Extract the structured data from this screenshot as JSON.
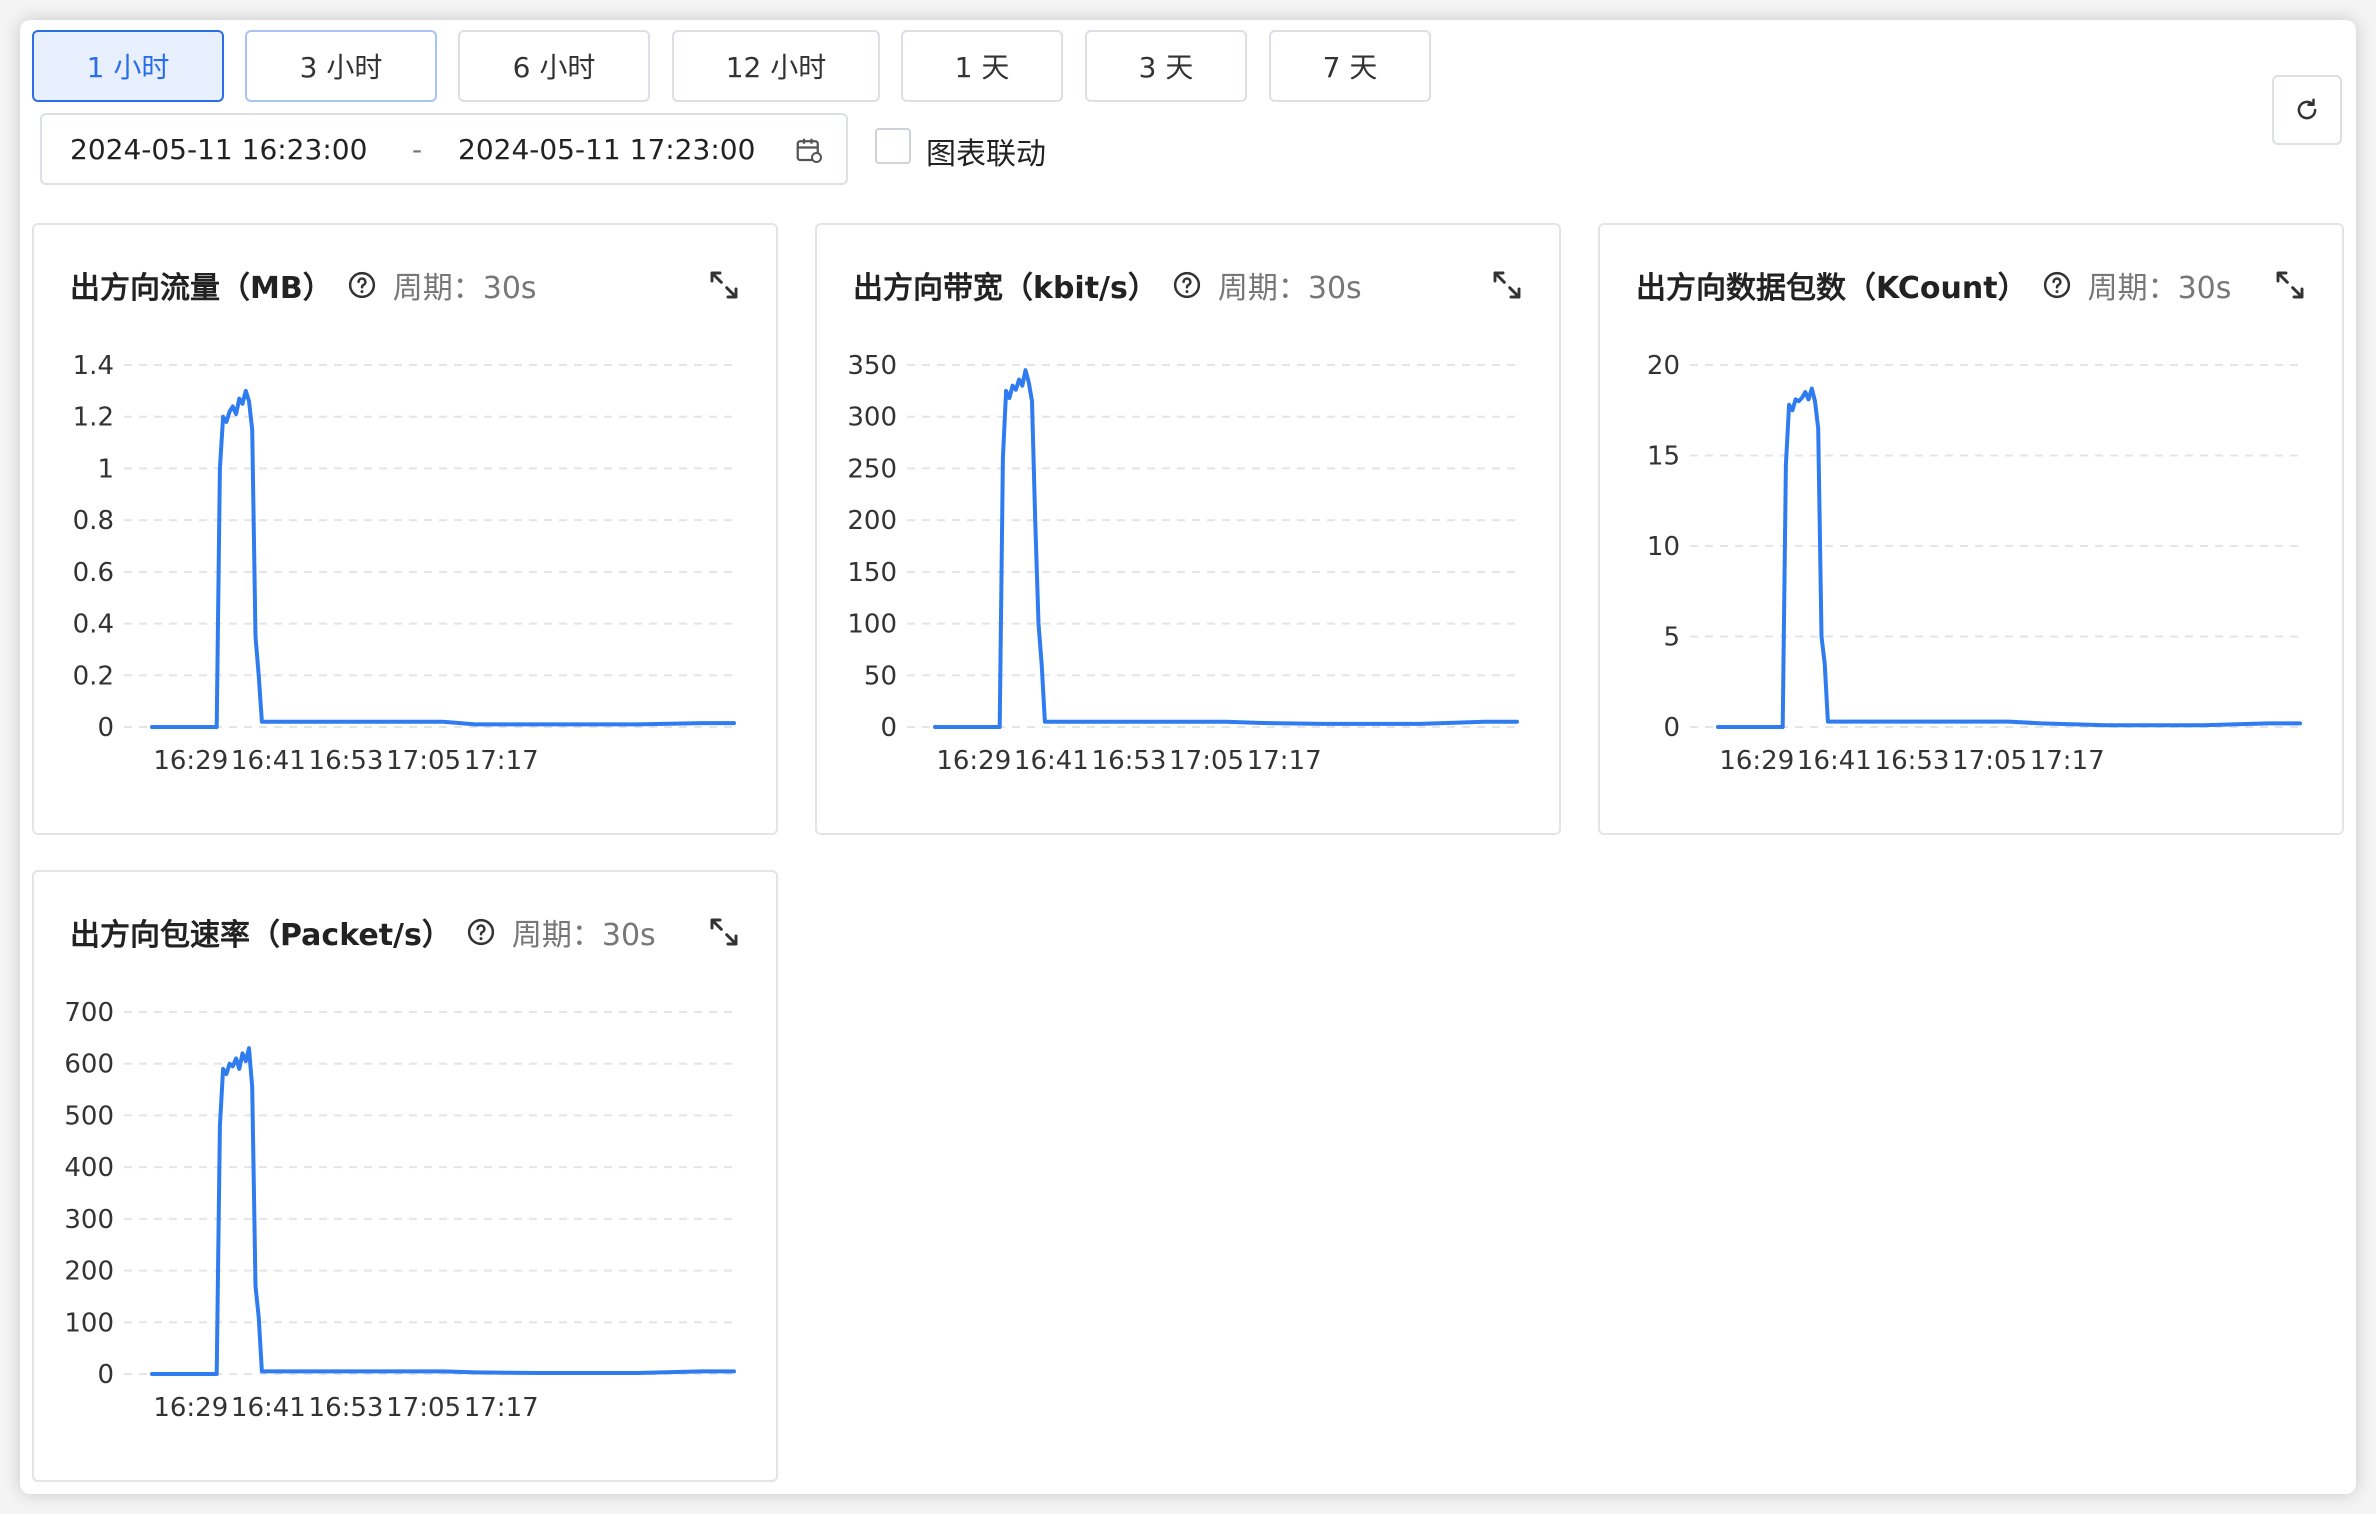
{
  "toolbar": {
    "ranges": [
      "1 小时",
      "3 小时",
      "6 小时",
      "12 小时",
      "1 天",
      "3 天",
      "7 天"
    ],
    "active_range": "1 小时",
    "date_start": "2024-05-11 16:23:00",
    "date_separator": "-",
    "date_end": "2024-05-11 17:23:00",
    "link_label": "图表联动",
    "link_checked": false
  },
  "colors": {
    "accent": "#2b6fe8",
    "line": "#2f7bf0",
    "grid": "#e3e5e8"
  },
  "chart_data": [
    {
      "type": "line",
      "title": "出方向流量（MB）",
      "period": "周期：30s",
      "xticks": [
        "16:29",
        "16:41",
        "16:53",
        "17:05",
        "17:17"
      ],
      "yticks": [
        "0",
        "0.2",
        "0.4",
        "0.6",
        "0.8",
        "1",
        "1.2",
        "1.4"
      ],
      "ylim": [
        0,
        1.4
      ],
      "x_minutes": [
        0,
        10,
        10.5,
        11,
        11.5,
        12,
        12.5,
        13,
        13.5,
        14,
        14.5,
        15,
        15.5,
        16,
        16.5,
        17,
        17.5,
        18,
        19,
        25,
        35,
        45,
        50,
        60,
        70,
        75,
        85,
        90
      ],
      "x_time": [
        "16:23:00",
        "16:33:00",
        "16:33:30",
        "16:34:00",
        "16:34:30",
        "16:35:00",
        "16:35:30",
        "16:36:00",
        "16:36:30",
        "16:37:00",
        "16:37:30",
        "16:38:00",
        "16:38:30",
        "16:39:00",
        "16:39:30",
        "16:40:00",
        "16:40:30",
        "16:41:00",
        "16:42:00",
        "16:48:00",
        "16:58:00",
        "17:08:00",
        "17:13:00",
        "17:23:00",
        "17:33:00",
        "17:38:00",
        "17:48:00",
        "17:53:00"
      ],
      "values": [
        0,
        0,
        1.0,
        1.2,
        1.18,
        1.22,
        1.24,
        1.21,
        1.27,
        1.25,
        1.3,
        1.26,
        1.15,
        0.35,
        0.2,
        0.02,
        0.02,
        0.02,
        0.02,
        0.02,
        0.02,
        0.02,
        0.01,
        0.01,
        0.01,
        0.01,
        0.015,
        0.015
      ]
    },
    {
      "type": "line",
      "title": "出方向带宽（kbit/s）",
      "period": "周期：30s",
      "xticks": [
        "16:29",
        "16:41",
        "16:53",
        "17:05",
        "17:17"
      ],
      "yticks": [
        "0",
        "50",
        "100",
        "150",
        "200",
        "250",
        "300",
        "350"
      ],
      "ylim": [
        0,
        350
      ],
      "x_time": [
        "16:23:00",
        "16:33:00",
        "16:33:30",
        "16:34:00",
        "16:34:30",
        "16:35:00",
        "16:35:30",
        "16:36:00",
        "16:36:30",
        "16:37:00",
        "16:37:30",
        "16:38:00",
        "16:38:30",
        "16:39:00",
        "16:39:30",
        "16:40:00",
        "16:40:30",
        "16:41:00",
        "16:42:00",
        "16:48:00",
        "16:58:00",
        "17:08:00",
        "17:13:00",
        "17:23:00",
        "17:33:00",
        "17:38:00",
        "17:48:00",
        "17:53:00"
      ],
      "values": [
        0,
        0,
        260,
        325,
        318,
        330,
        326,
        336,
        330,
        345,
        333,
        315,
        200,
        100,
        60,
        5,
        5,
        5,
        5,
        5,
        5,
        5,
        4,
        3,
        3,
        3,
        5,
        5
      ]
    },
    {
      "type": "line",
      "title": "出方向数据包数（KCount）",
      "period": "周期：30s",
      "xticks": [
        "16:29",
        "16:41",
        "16:53",
        "17:05",
        "17:17"
      ],
      "yticks": [
        "0",
        "5",
        "10",
        "15",
        "20"
      ],
      "ylim": [
        0,
        20
      ],
      "x_time": [
        "16:23:00",
        "16:33:00",
        "16:33:30",
        "16:34:00",
        "16:34:30",
        "16:35:00",
        "16:35:30",
        "16:36:00",
        "16:36:30",
        "16:37:00",
        "16:37:30",
        "16:38:00",
        "16:38:30",
        "16:39:00",
        "16:39:30",
        "16:40:00",
        "16:40:30",
        "16:41:00",
        "16:42:00",
        "16:48:00",
        "16:58:00",
        "17:08:00",
        "17:13:00",
        "17:23:00",
        "17:33:00",
        "17:38:00",
        "17:48:00",
        "17:53:00"
      ],
      "values": [
        0,
        0,
        14.5,
        17.8,
        17.5,
        18.1,
        18.0,
        18.2,
        18.5,
        18.1,
        18.7,
        18.0,
        16.5,
        5.0,
        3.5,
        0.3,
        0.3,
        0.3,
        0.3,
        0.3,
        0.3,
        0.3,
        0.2,
        0.1,
        0.1,
        0.1,
        0.2,
        0.2
      ]
    },
    {
      "type": "line",
      "title": "出方向包速率（Packet/s）",
      "period": "周期：30s",
      "xticks": [
        "16:29",
        "16:41",
        "16:53",
        "17:05",
        "17:17"
      ],
      "yticks": [
        "0",
        "100",
        "200",
        "300",
        "400",
        "500",
        "600",
        "700"
      ],
      "ylim": [
        0,
        700
      ],
      "x_time": [
        "16:23:00",
        "16:33:00",
        "16:33:30",
        "16:34:00",
        "16:34:30",
        "16:35:00",
        "16:35:30",
        "16:36:00",
        "16:36:30",
        "16:37:00",
        "16:37:30",
        "16:38:00",
        "16:38:30",
        "16:39:00",
        "16:39:30",
        "16:40:00",
        "16:40:30",
        "16:41:00",
        "16:42:00",
        "16:48:00",
        "16:58:00",
        "17:08:00",
        "17:13:00",
        "17:23:00",
        "17:33:00",
        "17:38:00",
        "17:48:00",
        "17:53:00"
      ],
      "values": [
        0,
        0,
        480,
        590,
        580,
        600,
        595,
        610,
        590,
        620,
        605,
        630,
        555,
        170,
        110,
        5,
        5,
        5,
        5,
        5,
        5,
        5,
        3,
        2,
        2,
        2,
        5,
        5
      ]
    }
  ]
}
